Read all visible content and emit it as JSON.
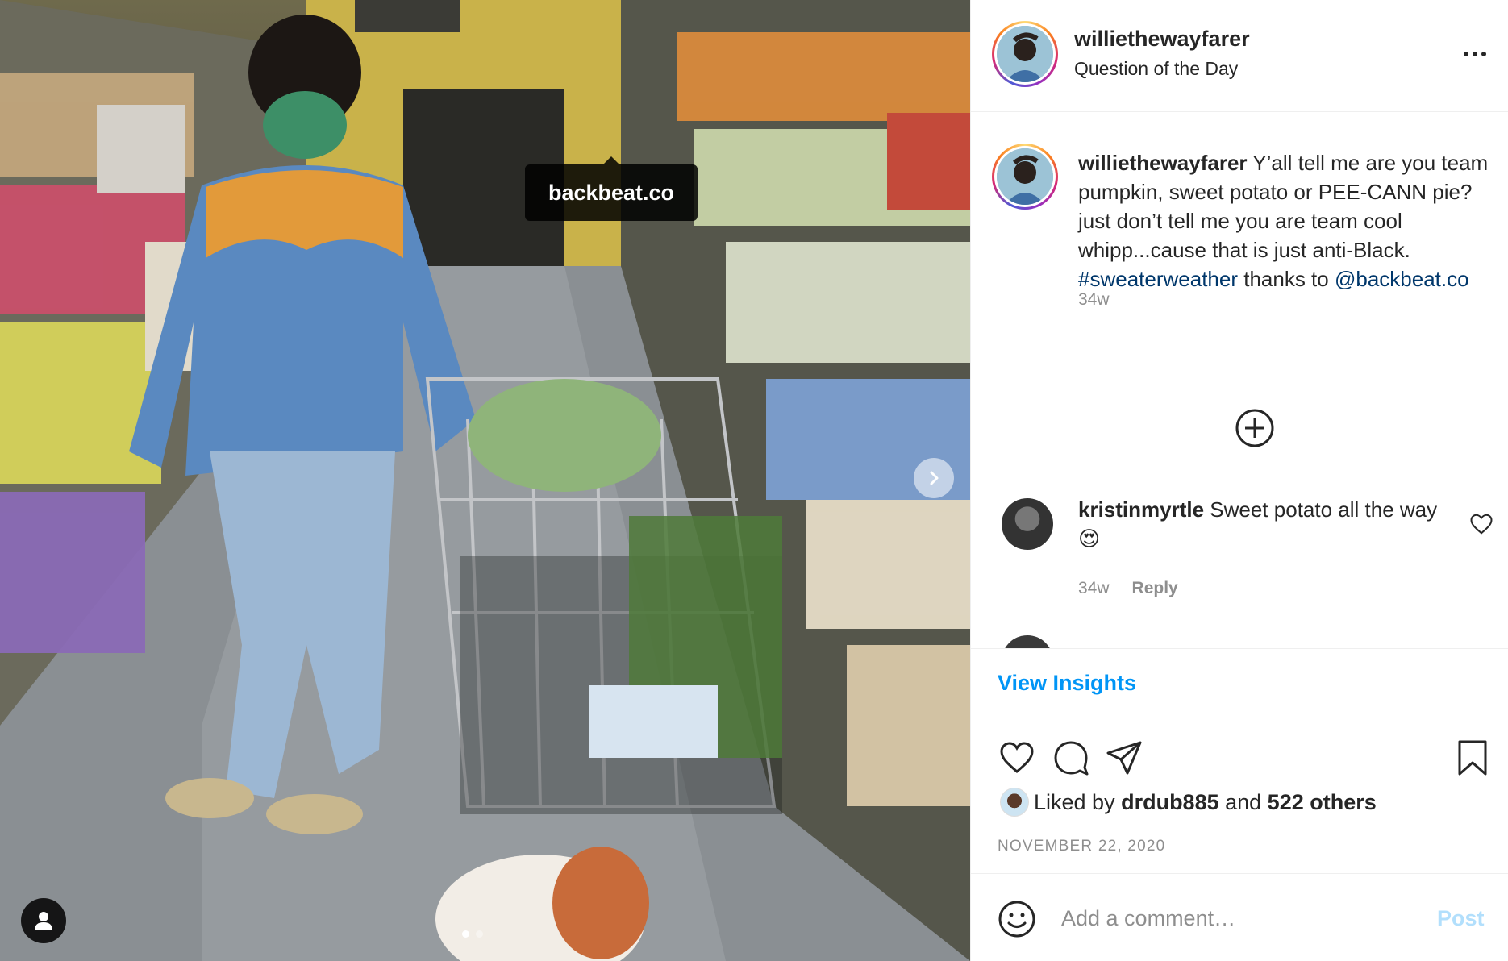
{
  "photo": {
    "tag_label": "backbeat.co",
    "next_icon": "chevron-right-icon",
    "tagged_user_icon": "user-icon",
    "carousel": {
      "count": 2,
      "active": 1
    }
  },
  "header": {
    "username": "williethewayfarer",
    "location": "Question of the Day",
    "more_icon": "more-horizontal-icon"
  },
  "caption": {
    "username": "williethewayfarer",
    "text_before": " Y’all tell me are you team pumpkin, sweet potato or PEE-CANN pie? just don’t tell me you are team cool whipp...cause that is just anti-Black. ",
    "hashtag": "#sweaterweather",
    "text_middle": " thanks to ",
    "mention": "@backbeat.co",
    "time": "34w"
  },
  "load_more_icon": "plus-circle-icon",
  "comments": [
    {
      "username": "kristinmyrtle",
      "text": " Sweet potato all the way ",
      "emoji": "😍",
      "time": "34w",
      "reply_label": "Reply"
    }
  ],
  "insights_label": "View Insights",
  "likes": {
    "prefix": "Liked by ",
    "user": "drdub885",
    "middle": " and ",
    "others": "522 others"
  },
  "date": "NOVEMBER 22, 2020",
  "add_comment": {
    "placeholder": "Add a comment…",
    "post_label": "Post"
  },
  "colors": {
    "link_blue": "#0095f6",
    "mention_blue": "#00376b",
    "post_disabled": "#b2dffc",
    "meta_gray": "#8e8e8e"
  }
}
